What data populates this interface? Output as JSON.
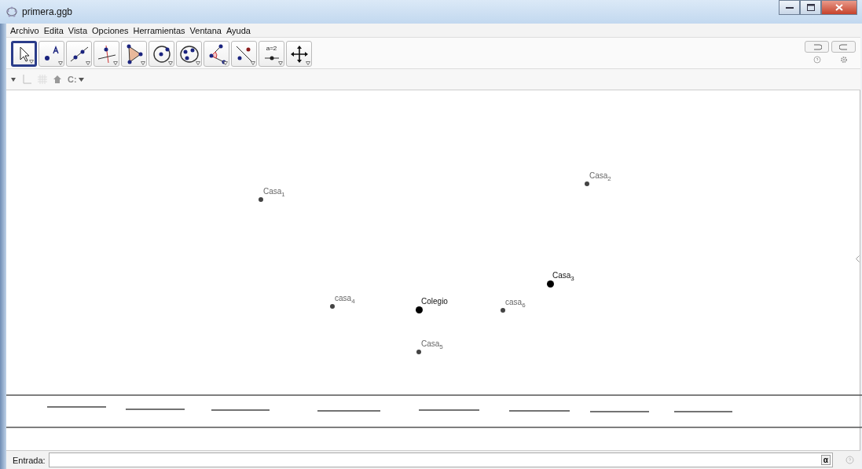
{
  "window": {
    "title": "primera.ggb"
  },
  "menu": [
    "Archivo",
    "Edita",
    "Vista",
    "Opciones",
    "Herramientas",
    "Ventana",
    "Ayuda"
  ],
  "tools": [
    {
      "kind": "move",
      "selected": true
    },
    {
      "kind": "point",
      "selected": false
    },
    {
      "kind": "line",
      "selected": false
    },
    {
      "kind": "perpendicular",
      "selected": false
    },
    {
      "kind": "polygon",
      "selected": false
    },
    {
      "kind": "circle",
      "selected": false
    },
    {
      "kind": "conic",
      "selected": false
    },
    {
      "kind": "angle",
      "selected": false
    },
    {
      "kind": "reflect",
      "selected": false
    },
    {
      "kind": "slider",
      "selected": false,
      "label": "a=2"
    },
    {
      "kind": "pan",
      "selected": false
    }
  ],
  "style_bar": {
    "capture_label": "C:"
  },
  "points": [
    {
      "label": "Casa$_{1}$",
      "highlighted": false
    },
    {
      "label": "Casa$_{2}$",
      "highlighted": false
    },
    {
      "label": "Casa$_{3}$",
      "highlighted": true
    },
    {
      "label": "casa$_{4}$",
      "highlighted": false
    },
    {
      "label": "Colegio",
      "highlighted": true
    },
    {
      "label": "casa$_{6}$",
      "highlighted": false
    },
    {
      "label": "Casa$_{5}$",
      "highlighted": false
    }
  ],
  "input_bar": {
    "label": "Entrada:",
    "symbol_button": "α"
  }
}
